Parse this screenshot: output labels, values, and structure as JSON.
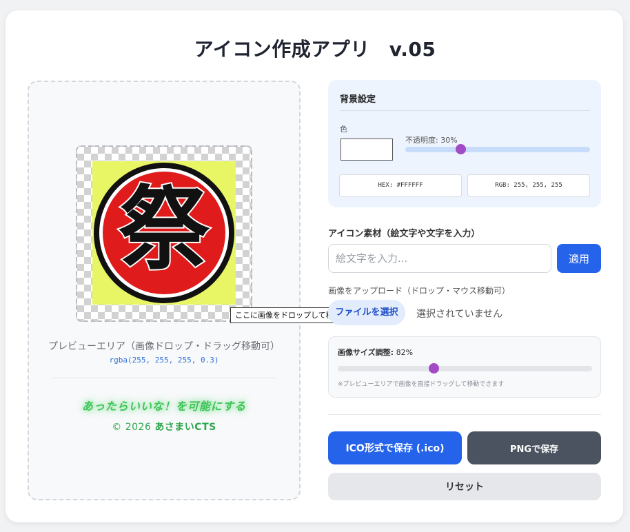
{
  "app": {
    "title": "アイコン作成アプリ",
    "version": "v.05"
  },
  "preview": {
    "icon_glyph": "祭",
    "drop_tooltip": "ここに画像をドロップして移動",
    "label": "プレビューエリア（画像ドロップ・ドラッグ移動可）",
    "rgba_text": "rgba(255, 255, 255, 0.3)",
    "slogan": "あったらいいな！を可能にする",
    "copyright_prefix": "© 2026",
    "copyright_name": "あさまいCTS"
  },
  "background": {
    "heading": "背景設定",
    "color_label": "色",
    "color_value": "#FFFFFF",
    "opacity_label": "不透明度: 30%",
    "opacity_percent": 30,
    "hex_text": "HEX: #FFFFFF",
    "rgb_text": "RGB: 255, 255, 255"
  },
  "material": {
    "label": "アイコン素材（絵文字や文字を入力）",
    "input_placeholder": "絵文字を入力...",
    "input_value": "",
    "apply_label": "適用"
  },
  "upload": {
    "label": "画像をアップロード（ドロップ・マウス移動可）",
    "file_button": "ファイルを選択",
    "file_status": "選択されていません"
  },
  "size": {
    "label_bold": "画像サイズ調整:",
    "label_value": "82%",
    "percent": 82,
    "hint": "※プレビューエリアで画像を直接ドラッグして移動できます"
  },
  "actions": {
    "save_ico": "ICO形式で保存 (.ico)",
    "save_png": "PNGで保存",
    "reset": "リセット"
  },
  "colors": {
    "accent_blue": "#2563eb",
    "slider_thumb": "#a24bc6",
    "icon_yellow": "#e8f565",
    "icon_red": "#e01b1b",
    "slogan_green": "#3fc45a"
  },
  "icons": {
    "preview_image": "matsuri-kanji-icon"
  }
}
